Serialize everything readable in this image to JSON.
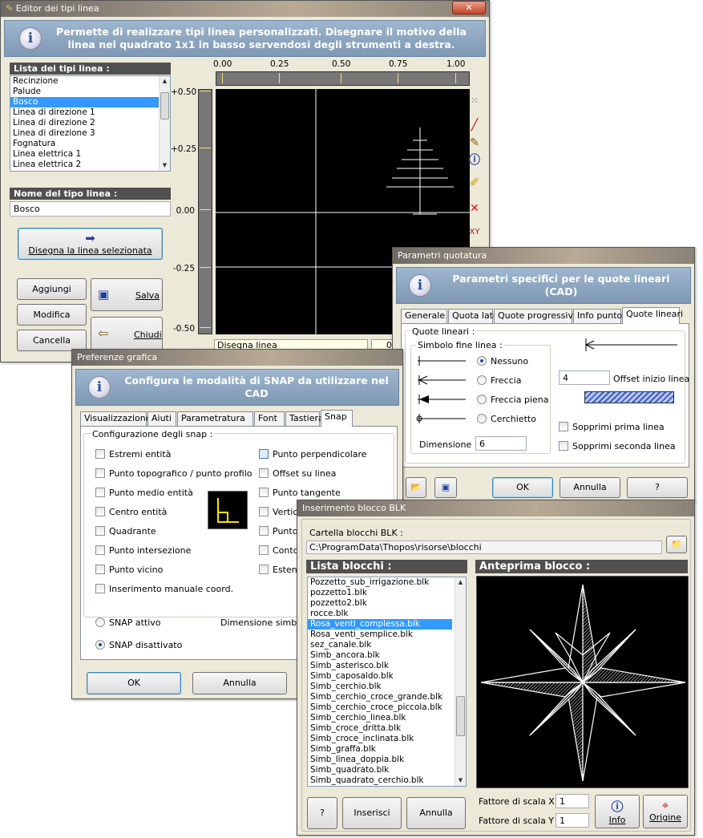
{
  "win1": {
    "title": "Editor dei tipi linea",
    "header": "Permette di realizzare tipi linea personalizzati. Disegnare il motivo della linea nel quadrato 1x1 in basso servendosi degli strumenti a destra.",
    "list_title": "Lista dei tipi linea :",
    "items": [
      "Recinzione",
      "Palude",
      "Bosco",
      "Linea di direzione 1",
      "Linea di direzione 2",
      "Linea di direzione 3",
      "Fognatura",
      "Linea elettrica 1",
      "Linea elettrica 2"
    ],
    "selected": 2,
    "name_title": "Nome del tipo linea :",
    "name_value": "Bosco",
    "draw_btn": "Disegna la linea selezionata",
    "add": "Aggiungi",
    "modify": "Modifica",
    "delete": "Cancella",
    "save": "Salva",
    "close": "Chiudi",
    "x_ticks": [
      "0.00",
      "0.25",
      "0.50",
      "0.75",
      "1.00"
    ],
    "y_ticks": [
      "+0.50",
      "+0.25",
      "0.00",
      "-0.25",
      "-0.50"
    ],
    "status": "Disegna linea",
    "status_val": "0"
  },
  "win2": {
    "title": "Parametri quotatura",
    "header": "Parametri specifici per le quote lineari (CAD)",
    "tabs": [
      "Generale",
      "Quota lato",
      "Quote progressive",
      "Info punto",
      "Quote lineari"
    ],
    "group": "Quote lineari :",
    "symbol_group": "Simbolo fine linea :",
    "radios": [
      "Nessuno",
      "Freccia",
      "Freccia piena",
      "Cerchietto"
    ],
    "dim_label": "Dimensione =",
    "dim_value": "6",
    "offset_value": "4",
    "offset_label": "Offset inizio linea",
    "cb1": "Sopprimi prima linea",
    "cb2": "Sopprimi seconda linea",
    "ok": "OK",
    "cancel": "Annulla",
    "help": "?"
  },
  "win3": {
    "title": "Preferenze grafica",
    "header": "Configura le modalità di SNAP da utilizzare nel CAD",
    "tabs": [
      "Visualizzazione",
      "Aiuti",
      "Parametratura",
      "Font",
      "Tastiera",
      "Snap"
    ],
    "group": "Configurazione degli snap :",
    "left": [
      "Estremi entità",
      "Punto topografico / punto profilo",
      "Punto medio entità",
      "Centro entità",
      "Quadrante",
      "Punto intersezione",
      "Punto vicino",
      "Inserimento manuale coord."
    ],
    "right": [
      "Punto perpendicolare",
      "Offset su linea",
      "Punto tangente",
      "Vertice",
      "Punto",
      "Contor",
      "Estens"
    ],
    "snap_on": "SNAP attivo",
    "snap_off": "SNAP disattivato",
    "dim_symbol": "Dimensione simbolo",
    "ok": "OK",
    "cancel": "Annulla"
  },
  "win4": {
    "title": "Inserimento blocco BLK",
    "folder_label": "Cartella blocchi BLK :",
    "folder": "C:\\ProgramData\\Thopos\\risorse\\blocchi",
    "list_title": "Lista blocchi :",
    "preview_title": "Anteprima blocco :",
    "items": [
      "Pozzetto_sub_irrigazione.blk",
      "pozzetto1.blk",
      "pozzetto2.blk",
      "rocce.blk",
      "Rosa_venti_complessa.blk",
      "Rosa_venti_semplice.blk",
      "sez_canale.blk",
      "Simb_ancora.blk",
      "Simb_asterisco.blk",
      "Simb_caposaldo.blk",
      "Simb_cerchio.blk",
      "Simb_cerchio_croce_grande.blk",
      "Simb_cerchio_croce_piccola.blk",
      "Simb_cerchio_linea.blk",
      "Simb_croce_dritta.blk",
      "Simb_croce_inclinata.blk",
      "Simb_graffa.blk",
      "Simb_linea_doppia.blk",
      "Simb_quadrato.blk",
      "Simb_quadrato_cerchio.blk"
    ],
    "selected": 4,
    "help": "?",
    "insert": "Inserisci",
    "cancel": "Annulla",
    "scale_x_label": "Fattore di scala X =",
    "scale_x": "1",
    "scale_y_label": "Fattore di scala Y =",
    "scale_y": "1",
    "info": "Info",
    "origin": "Origine"
  }
}
